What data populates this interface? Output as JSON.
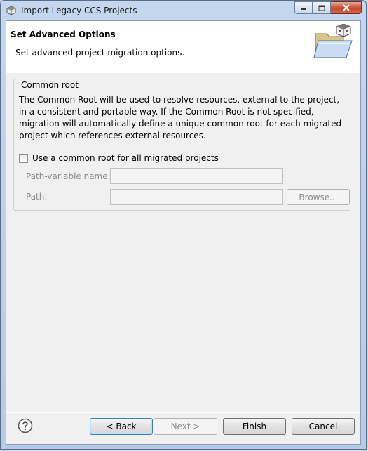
{
  "window": {
    "title": "Import Legacy CCS Projects",
    "icons": {
      "app": "ccs-logo-icon",
      "minimize": "minimize-icon",
      "maximize": "maximize-icon",
      "close": "close-icon"
    }
  },
  "header": {
    "title": "Set Advanced Options",
    "description": "Set advanced project migration options.",
    "banner_icon": "folder-with-package-icon"
  },
  "common_root": {
    "group_label": "Common root",
    "description": "The Common Root will be used to resolve resources, external to the project, in a consistent and portable way. If the Common Root is not specified, migration will automatically define a unique common root for each migrated project which references external resources.",
    "checkbox_label": "Use a common root for all migrated projects",
    "checkbox_checked": false,
    "path_variable_label": "Path-variable name:",
    "path_variable_value": "",
    "path_label": "Path:",
    "path_value": "",
    "browse_label": "Browse..."
  },
  "footer": {
    "help_icon": "help-icon",
    "back_label": "< Back",
    "next_label": "Next >",
    "finish_label": "Finish",
    "cancel_label": "Cancel"
  }
}
